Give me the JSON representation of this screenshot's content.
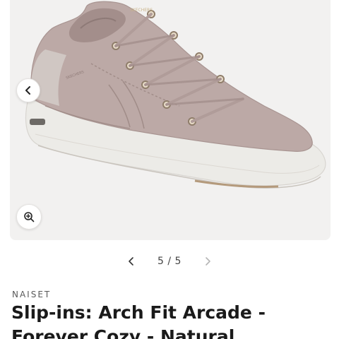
{
  "gallery": {
    "image_alt": "Skechers Slip-ins Arch Fit Arcade women's lace-up sneaker in taupe suede",
    "shoe_logo_text": "SKECHERS",
    "prev_icon": "chevron-left-icon",
    "zoom_icon": "zoom-in-icon"
  },
  "pager": {
    "counter": "5 / 5",
    "prev_icon": "chevron-left-icon",
    "next_icon": "chevron-right-icon"
  },
  "product": {
    "brand": "NAISET",
    "title": "Slip-ins: Arch Fit Arcade - Forever Cozy - Natural"
  },
  "colors": {
    "image_background": "#f2f1f0",
    "shoe_upper": "#bca9a6",
    "sole": "#ecebe7",
    "text_primary": "#1a1a1a"
  }
}
